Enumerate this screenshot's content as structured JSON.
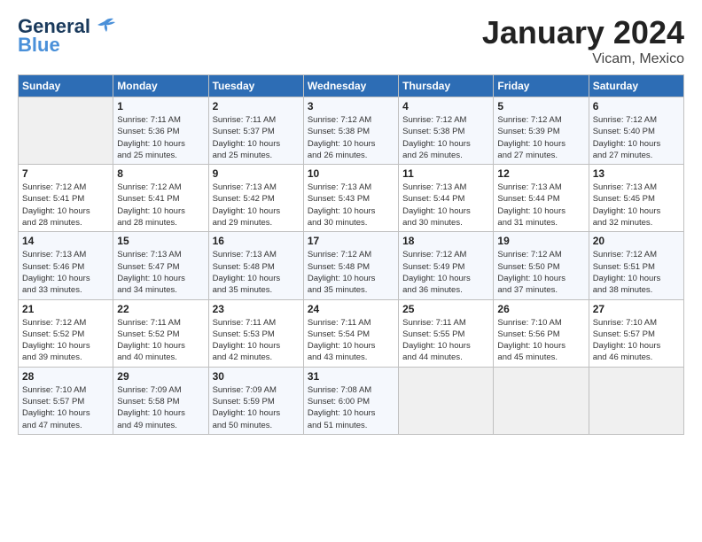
{
  "logo": {
    "line1": "General",
    "line2": "Blue"
  },
  "title": "January 2024",
  "subtitle": "Vicam, Mexico",
  "header_days": [
    "Sunday",
    "Monday",
    "Tuesday",
    "Wednesday",
    "Thursday",
    "Friday",
    "Saturday"
  ],
  "weeks": [
    [
      {
        "day": "",
        "info": ""
      },
      {
        "day": "1",
        "info": "Sunrise: 7:11 AM\nSunset: 5:36 PM\nDaylight: 10 hours\nand 25 minutes."
      },
      {
        "day": "2",
        "info": "Sunrise: 7:11 AM\nSunset: 5:37 PM\nDaylight: 10 hours\nand 25 minutes."
      },
      {
        "day": "3",
        "info": "Sunrise: 7:12 AM\nSunset: 5:38 PM\nDaylight: 10 hours\nand 26 minutes."
      },
      {
        "day": "4",
        "info": "Sunrise: 7:12 AM\nSunset: 5:38 PM\nDaylight: 10 hours\nand 26 minutes."
      },
      {
        "day": "5",
        "info": "Sunrise: 7:12 AM\nSunset: 5:39 PM\nDaylight: 10 hours\nand 27 minutes."
      },
      {
        "day": "6",
        "info": "Sunrise: 7:12 AM\nSunset: 5:40 PM\nDaylight: 10 hours\nand 27 minutes."
      }
    ],
    [
      {
        "day": "7",
        "info": "Sunrise: 7:12 AM\nSunset: 5:41 PM\nDaylight: 10 hours\nand 28 minutes."
      },
      {
        "day": "8",
        "info": "Sunrise: 7:12 AM\nSunset: 5:41 PM\nDaylight: 10 hours\nand 28 minutes."
      },
      {
        "day": "9",
        "info": "Sunrise: 7:13 AM\nSunset: 5:42 PM\nDaylight: 10 hours\nand 29 minutes."
      },
      {
        "day": "10",
        "info": "Sunrise: 7:13 AM\nSunset: 5:43 PM\nDaylight: 10 hours\nand 30 minutes."
      },
      {
        "day": "11",
        "info": "Sunrise: 7:13 AM\nSunset: 5:44 PM\nDaylight: 10 hours\nand 30 minutes."
      },
      {
        "day": "12",
        "info": "Sunrise: 7:13 AM\nSunset: 5:44 PM\nDaylight: 10 hours\nand 31 minutes."
      },
      {
        "day": "13",
        "info": "Sunrise: 7:13 AM\nSunset: 5:45 PM\nDaylight: 10 hours\nand 32 minutes."
      }
    ],
    [
      {
        "day": "14",
        "info": "Sunrise: 7:13 AM\nSunset: 5:46 PM\nDaylight: 10 hours\nand 33 minutes."
      },
      {
        "day": "15",
        "info": "Sunrise: 7:13 AM\nSunset: 5:47 PM\nDaylight: 10 hours\nand 34 minutes."
      },
      {
        "day": "16",
        "info": "Sunrise: 7:13 AM\nSunset: 5:48 PM\nDaylight: 10 hours\nand 35 minutes."
      },
      {
        "day": "17",
        "info": "Sunrise: 7:12 AM\nSunset: 5:48 PM\nDaylight: 10 hours\nand 35 minutes."
      },
      {
        "day": "18",
        "info": "Sunrise: 7:12 AM\nSunset: 5:49 PM\nDaylight: 10 hours\nand 36 minutes."
      },
      {
        "day": "19",
        "info": "Sunrise: 7:12 AM\nSunset: 5:50 PM\nDaylight: 10 hours\nand 37 minutes."
      },
      {
        "day": "20",
        "info": "Sunrise: 7:12 AM\nSunset: 5:51 PM\nDaylight: 10 hours\nand 38 minutes."
      }
    ],
    [
      {
        "day": "21",
        "info": "Sunrise: 7:12 AM\nSunset: 5:52 PM\nDaylight: 10 hours\nand 39 minutes."
      },
      {
        "day": "22",
        "info": "Sunrise: 7:11 AM\nSunset: 5:52 PM\nDaylight: 10 hours\nand 40 minutes."
      },
      {
        "day": "23",
        "info": "Sunrise: 7:11 AM\nSunset: 5:53 PM\nDaylight: 10 hours\nand 42 minutes."
      },
      {
        "day": "24",
        "info": "Sunrise: 7:11 AM\nSunset: 5:54 PM\nDaylight: 10 hours\nand 43 minutes."
      },
      {
        "day": "25",
        "info": "Sunrise: 7:11 AM\nSunset: 5:55 PM\nDaylight: 10 hours\nand 44 minutes."
      },
      {
        "day": "26",
        "info": "Sunrise: 7:10 AM\nSunset: 5:56 PM\nDaylight: 10 hours\nand 45 minutes."
      },
      {
        "day": "27",
        "info": "Sunrise: 7:10 AM\nSunset: 5:57 PM\nDaylight: 10 hours\nand 46 minutes."
      }
    ],
    [
      {
        "day": "28",
        "info": "Sunrise: 7:10 AM\nSunset: 5:57 PM\nDaylight: 10 hours\nand 47 minutes."
      },
      {
        "day": "29",
        "info": "Sunrise: 7:09 AM\nSunset: 5:58 PM\nDaylight: 10 hours\nand 49 minutes."
      },
      {
        "day": "30",
        "info": "Sunrise: 7:09 AM\nSunset: 5:59 PM\nDaylight: 10 hours\nand 50 minutes."
      },
      {
        "day": "31",
        "info": "Sunrise: 7:08 AM\nSunset: 6:00 PM\nDaylight: 10 hours\nand 51 minutes."
      },
      {
        "day": "",
        "info": ""
      },
      {
        "day": "",
        "info": ""
      },
      {
        "day": "",
        "info": ""
      }
    ]
  ]
}
